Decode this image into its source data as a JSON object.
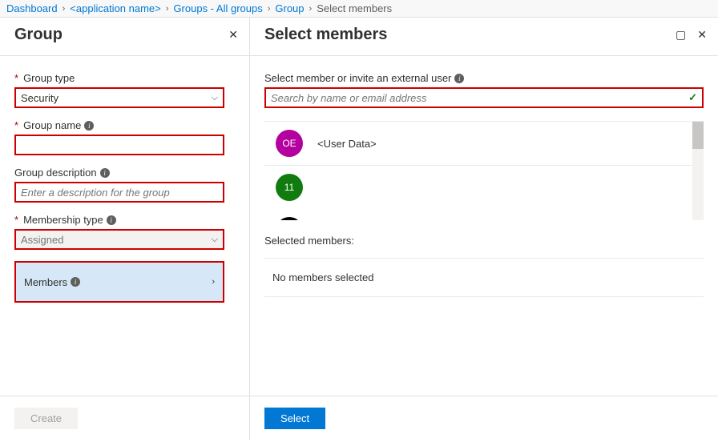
{
  "breadcrumb": {
    "dashboard": "Dashboard",
    "app": "<application name>",
    "groups": "Groups - All groups",
    "group": "Group",
    "select": "Select members"
  },
  "left": {
    "title": "Group",
    "group_type_label": "Group type",
    "group_type_value": "Security",
    "group_name_label": "Group name",
    "group_name_value": "",
    "group_desc_label": "Group description",
    "group_desc_placeholder": "Enter a description for the group",
    "membership_type_label": "Membership type",
    "membership_type_value": "Assigned",
    "members_label": "Members",
    "create_button": "Create"
  },
  "right": {
    "title": "Select members",
    "search_label": "Select member or invite an external user",
    "search_placeholder": "Search by name or email address",
    "list": [
      {
        "initials": "OE",
        "name": "<User Data>",
        "color": "magenta"
      },
      {
        "initials": "11",
        "name": "",
        "color": "green"
      }
    ],
    "selected_heading": "Selected members:",
    "selected_empty": "No members selected",
    "select_button": "Select"
  }
}
